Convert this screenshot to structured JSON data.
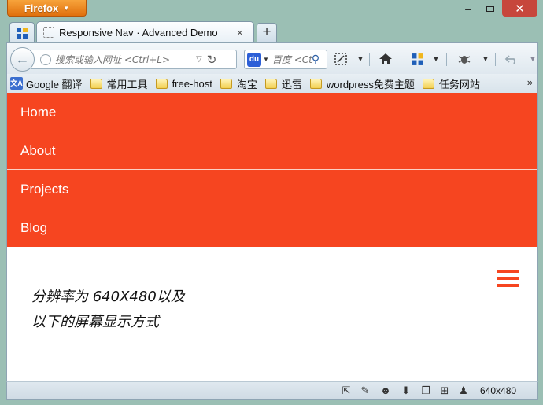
{
  "window": {
    "app_button": "Firefox",
    "minimize": "–",
    "close": "✕"
  },
  "tabs": {
    "active_title": "Responsive Nav · Advanced Demo",
    "close": "×",
    "new_tab": "+"
  },
  "navbar": {
    "url_placeholder": "搜索或输入网址 <Ctrl+L>",
    "search_placeholder": "百度 <Ct",
    "search_engine_glyph": "du"
  },
  "bookmarks": [
    {
      "label": "Google 翻译",
      "icon": "google-translate-icon"
    },
    {
      "label": "常用工具",
      "icon": "folder-icon"
    },
    {
      "label": "free-host",
      "icon": "folder-icon"
    },
    {
      "label": "淘宝",
      "icon": "folder-icon"
    },
    {
      "label": "迅雷",
      "icon": "folder-icon"
    },
    {
      "label": "wordpress免费主题",
      "icon": "folder-icon"
    },
    {
      "label": "任务网站",
      "icon": "folder-icon"
    }
  ],
  "bookmarks_more": "»",
  "page": {
    "nav_items": [
      "Home",
      "About",
      "Projects",
      "Blog"
    ],
    "note_line1": "分辨率为 640X480以及",
    "note_line2": "以下的屏幕显示方式",
    "accent_color": "#f64520"
  },
  "statusbar": {
    "resolution": "640x480"
  }
}
